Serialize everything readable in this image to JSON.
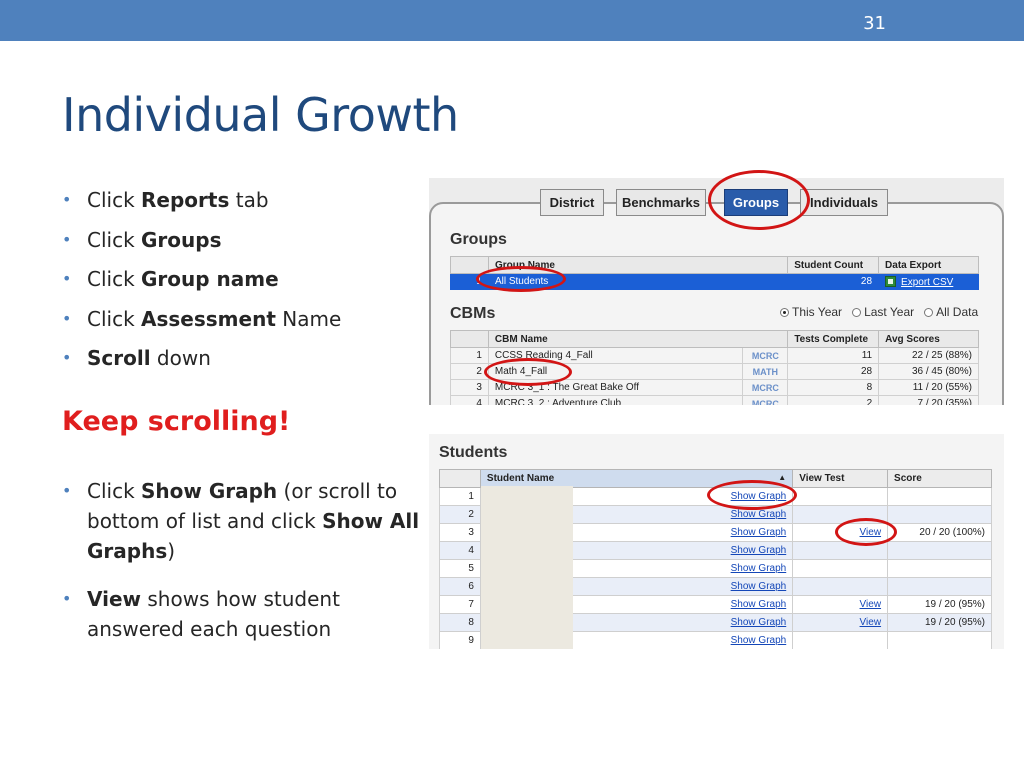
{
  "slide": {
    "number": "31",
    "title": "Individual Growth",
    "bullets_1": [
      {
        "prefix": "Click ",
        "bold": "Reports",
        "suffix": " tab"
      },
      {
        "prefix": "Click ",
        "bold": "Groups",
        "suffix": ""
      },
      {
        "prefix": "Click ",
        "bold": "Group name",
        "suffix": ""
      },
      {
        "prefix": "Click ",
        "bold": "Assessment",
        "suffix": " Name"
      },
      {
        "prefix": "",
        "bold": "Scroll",
        "suffix": " down"
      }
    ],
    "keep_scrolling": "Keep scrolling!",
    "bullets_2": [
      {
        "p1": "Click ",
        "b1": "Show Graph",
        "p2": " (or scroll to bottom of list and click ",
        "b2": "Show All Graphs",
        "p3": ")"
      },
      {
        "p1": "",
        "b1": "View",
        "p2": " shows how student answered each question",
        "b2": "",
        "p3": ""
      }
    ]
  },
  "screenshot1": {
    "tabs": [
      "District",
      "Benchmarks",
      "Groups",
      "Individuals"
    ],
    "active_tab": "Groups",
    "groups_heading": "Groups",
    "groups_columns": [
      "Group Name",
      "Student Count",
      "Data Export"
    ],
    "groups_rows": [
      {
        "index": "1",
        "name": "All Students",
        "count": "28",
        "export": "Export CSV"
      }
    ],
    "cbms_heading": "CBMs",
    "range_options": [
      "This Year",
      "Last Year",
      "All Data"
    ],
    "range_selected": "This Year",
    "cbm_columns": [
      "CBM Name",
      "Tests Complete",
      "Avg Scores"
    ],
    "cbm_rows": [
      {
        "index": "1",
        "name": "CCSS Reading 4_Fall",
        "tag": "MCRC",
        "tests": "11",
        "avg": "22 / 25 (88%)"
      },
      {
        "index": "2",
        "name": "Math 4_Fall",
        "tag": "MATH",
        "tests": "28",
        "avg": "36 / 45 (80%)"
      },
      {
        "index": "3",
        "name": "MCRC 3_1 : The Great Bake Off",
        "tag": "MCRC",
        "tests": "8",
        "avg": "11 / 20 (55%)"
      },
      {
        "index": "4",
        "name": "MCRC 3_2 : Adventure Club",
        "tag": "MCRC",
        "tests": "2",
        "avg": "7 / 20 (35%)"
      }
    ]
  },
  "screenshot2": {
    "heading": "Students",
    "columns": [
      "Student Name",
      "View Test",
      "Score"
    ],
    "sort_indicator": "▲",
    "rows": [
      {
        "index": "1",
        "graph": "Show Graph",
        "view": "",
        "score": ""
      },
      {
        "index": "2",
        "graph": "Show Graph",
        "view": "",
        "score": ""
      },
      {
        "index": "3",
        "graph": "Show Graph",
        "view": "View",
        "score": "20 / 20 (100%)"
      },
      {
        "index": "4",
        "graph": "Show Graph",
        "view": "",
        "score": ""
      },
      {
        "index": "5",
        "graph": "Show Graph",
        "view": "",
        "score": ""
      },
      {
        "index": "6",
        "graph": "Show Graph",
        "view": "",
        "score": ""
      },
      {
        "index": "7",
        "graph": "Show Graph",
        "view": "View",
        "score": "19 / 20 (95%)"
      },
      {
        "index": "8",
        "graph": "Show Graph",
        "view": "View",
        "score": "19 / 20 (95%)"
      },
      {
        "index": "9",
        "graph": "Show Graph",
        "view": "",
        "score": ""
      }
    ]
  },
  "colors": {
    "accent_bar": "#4f81bd",
    "title": "#1f497d",
    "highlight_red": "#d21515",
    "selected_row": "#1b5fd6"
  }
}
